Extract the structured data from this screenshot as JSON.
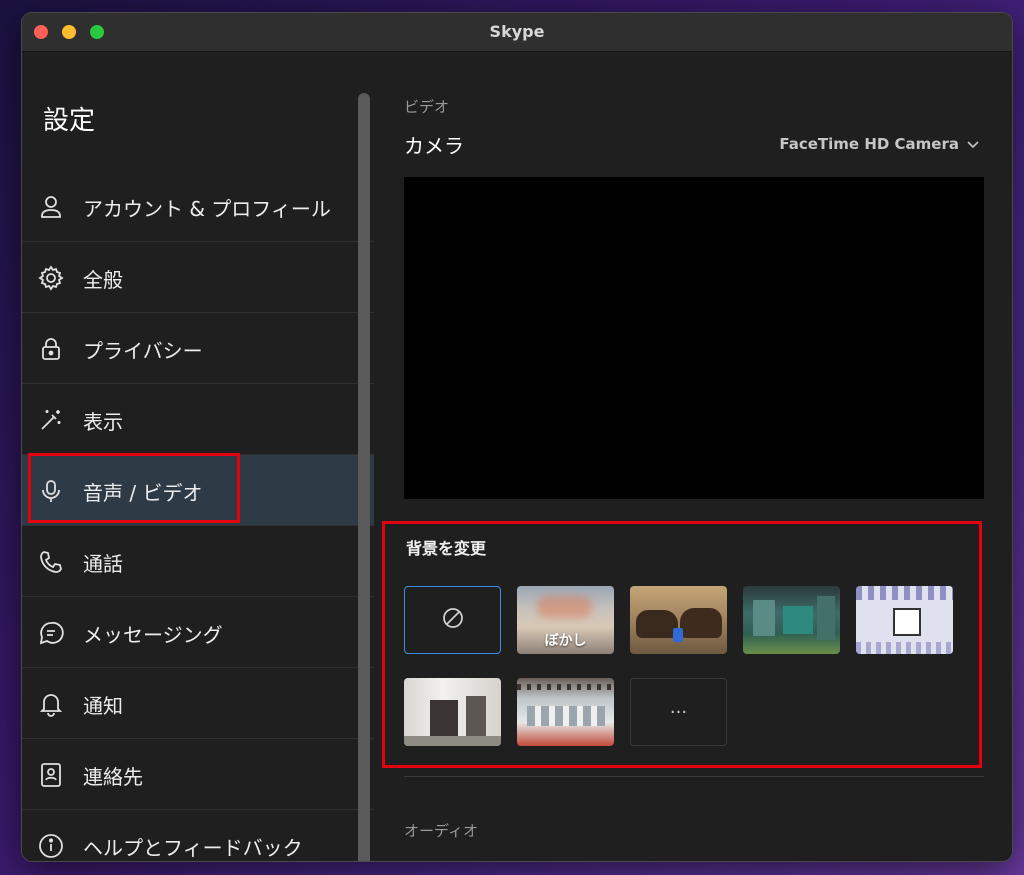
{
  "window": {
    "title": "Skype"
  },
  "sidebar": {
    "title": "設定",
    "items": [
      {
        "label": "アカウント & プロフィール",
        "icon": "person-icon"
      },
      {
        "label": "全般",
        "icon": "gear-icon"
      },
      {
        "label": "プライバシー",
        "icon": "lock-icon"
      },
      {
        "label": "表示",
        "icon": "magic-wand-icon"
      },
      {
        "label": "音声 / ビデオ",
        "icon": "microphone-icon",
        "active": true
      },
      {
        "label": "通話",
        "icon": "phone-icon"
      },
      {
        "label": "メッセージング",
        "icon": "chat-bubble-icon"
      },
      {
        "label": "通知",
        "icon": "bell-icon"
      },
      {
        "label": "連絡先",
        "icon": "contact-card-icon"
      },
      {
        "label": "ヘルプとフィードバック",
        "icon": "info-icon"
      }
    ]
  },
  "main": {
    "video_section_label": "ビデオ",
    "camera_label": "カメラ",
    "camera_selected": "FaceTime HD Camera",
    "background": {
      "title": "背景を変更",
      "options": [
        {
          "name": "none",
          "label": ""
        },
        {
          "name": "blur",
          "label": "ぼかし"
        },
        {
          "name": "bison",
          "label": ""
        },
        {
          "name": "office-room",
          "label": ""
        },
        {
          "name": "pattern",
          "label": ""
        },
        {
          "name": "hallway",
          "label": ""
        },
        {
          "name": "loft",
          "label": ""
        },
        {
          "name": "more",
          "label": "···"
        }
      ]
    },
    "audio_section_label": "オーディオ"
  },
  "colors": {
    "accent": "#3d8be0",
    "highlight": "#e3000f",
    "active_bg": "#2f3a47"
  }
}
